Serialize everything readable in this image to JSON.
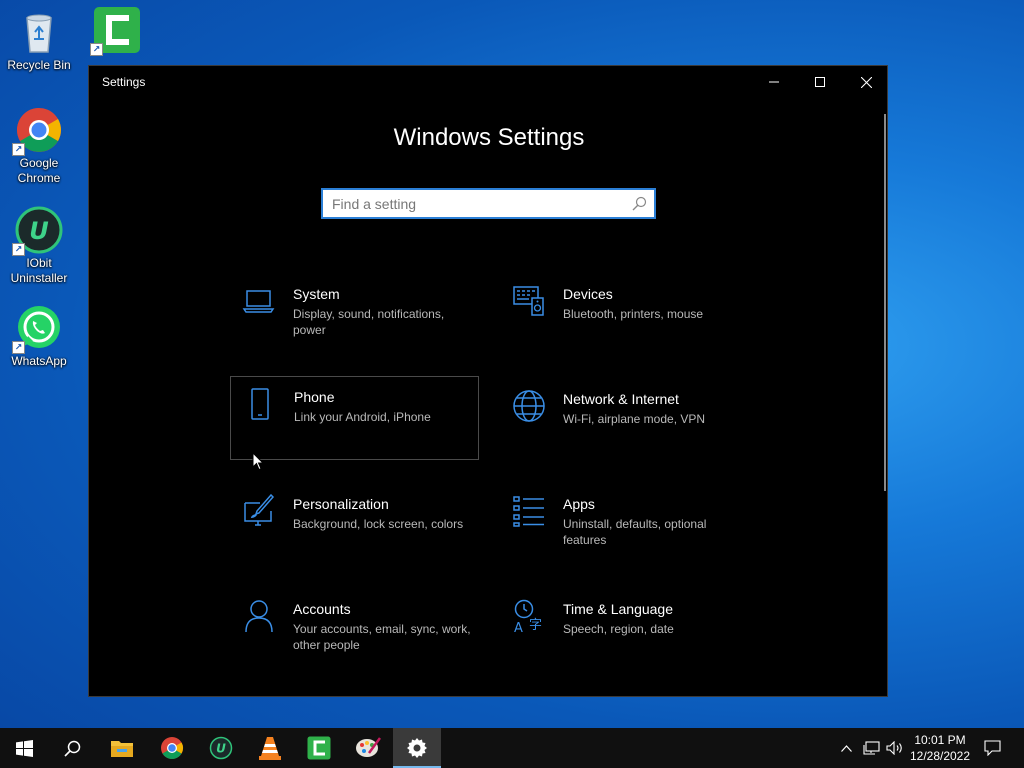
{
  "desktop": {
    "icons": [
      {
        "label": "Recycle Bin",
        "icon": "recycle-bin-icon"
      },
      {
        "label": "Google Chrome",
        "icon": "chrome-icon"
      },
      {
        "label": "IObit Uninstaller",
        "icon": "iobit-icon"
      },
      {
        "label": "WhatsApp",
        "icon": "whatsapp-icon"
      },
      {
        "label": "Camtasia",
        "icon": "camtasia-icon"
      }
    ]
  },
  "window": {
    "title": "Settings",
    "heading": "Windows Settings",
    "search_placeholder": "Find a setting",
    "tiles": [
      {
        "title": "System",
        "desc": "Display, sound, notifications, power",
        "icon": "laptop-icon"
      },
      {
        "title": "Devices",
        "desc": "Bluetooth, printers, mouse",
        "icon": "devices-icon"
      },
      {
        "title": "Phone",
        "desc": "Link your Android, iPhone",
        "icon": "phone-icon"
      },
      {
        "title": "Network & Internet",
        "desc": "Wi-Fi, airplane mode, VPN",
        "icon": "globe-icon"
      },
      {
        "title": "Personalization",
        "desc": "Background, lock screen, colors",
        "icon": "personalization-icon"
      },
      {
        "title": "Apps",
        "desc": "Uninstall, defaults, optional features",
        "icon": "apps-list-icon"
      },
      {
        "title": "Accounts",
        "desc": "Your accounts, email, sync, work, other people",
        "icon": "person-icon"
      },
      {
        "title": "Time & Language",
        "desc": "Speech, region, date",
        "icon": "time-language-icon"
      }
    ]
  },
  "taskbar": {
    "items": [
      "start-icon",
      "search-icon",
      "file-explorer-icon",
      "chrome-icon",
      "iobit-icon",
      "vlc-icon",
      "camtasia-icon",
      "paint-icon",
      "settings-gear-icon"
    ],
    "clock": {
      "time": "10:01 PM",
      "date": "12/28/2022"
    }
  },
  "colors": {
    "accent": "#2b7fd6",
    "icon_blue": "#3a8ee6",
    "window_bg": "#000000"
  }
}
